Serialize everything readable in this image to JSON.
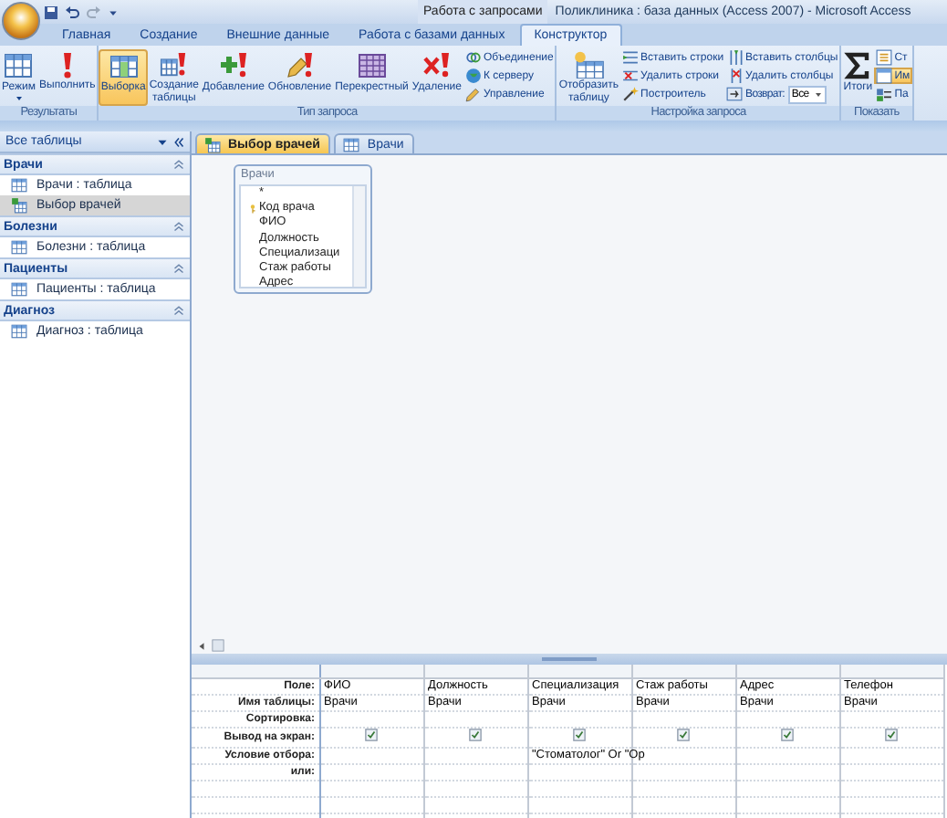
{
  "title_bar": {
    "context_label": "Работа с запросами",
    "title": "Поликлиника : база данных (Access 2007) - Microsoft Access"
  },
  "ribbon_tabs": [
    {
      "label": "Главная",
      "selected": false
    },
    {
      "label": "Создание",
      "selected": false
    },
    {
      "label": "Внешние данные",
      "selected": false
    },
    {
      "label": "Работа с базами данных",
      "selected": false
    },
    {
      "label": "Конструктор",
      "selected": true
    }
  ],
  "ribbon_groups": [
    {
      "label": "Результаты",
      "items": [
        {
          "kind": "large",
          "label": "Режим",
          "has_menu": true
        },
        {
          "kind": "large",
          "label": "Выполнить"
        }
      ]
    },
    {
      "label": "Тип запроса",
      "items": [
        {
          "kind": "large",
          "label": "Выборка",
          "selected": true
        },
        {
          "kind": "large",
          "label": "Создание таблицы",
          "selected": false
        },
        {
          "kind": "large",
          "label": "Добавление",
          "selected": false
        },
        {
          "kind": "large",
          "label": "Обновление",
          "selected": false
        },
        {
          "kind": "large",
          "label": "Перекрестный",
          "selected": false
        },
        {
          "kind": "large",
          "label": "Удаление",
          "selected": false
        },
        {
          "kind": "small",
          "label": "Объединение",
          "selected": false
        },
        {
          "kind": "small",
          "label": "К серверу",
          "selected": false
        },
        {
          "kind": "small",
          "label": "Управление",
          "selected": false
        }
      ]
    },
    {
      "label": "Настройка запроса",
      "items": [
        {
          "kind": "large",
          "label": "Отобразить таблицу"
        },
        {
          "kind": "small",
          "label": "Вставить строки"
        },
        {
          "kind": "small",
          "label": "Удалить строки"
        },
        {
          "kind": "small",
          "label": "Построитель"
        },
        {
          "kind": "small",
          "label": "Вставить столбцы"
        },
        {
          "kind": "small",
          "label": "Удалить столбцы"
        },
        {
          "kind": "combo",
          "label": "Возврат:",
          "value": "Все"
        }
      ]
    },
    {
      "label": "Показать",
      "items": [
        {
          "kind": "large",
          "label": "Итоги",
          "selected": false
        },
        {
          "kind": "small",
          "label": "Ст",
          "selected": false
        },
        {
          "kind": "small",
          "label": "Им",
          "selected": true
        },
        {
          "kind": "small",
          "label": "Па",
          "selected": false
        }
      ]
    }
  ],
  "navigation_pane": {
    "title": "Все таблицы",
    "groups": [
      {
        "label": "Врачи",
        "items": [
          {
            "kind": "table",
            "label": "Врачи : таблица",
            "selected": false
          },
          {
            "kind": "query",
            "label": "Выбор врачей",
            "selected": true
          }
        ]
      },
      {
        "label": "Болезни",
        "items": [
          {
            "kind": "table",
            "label": "Болезни : таблица",
            "selected": false
          }
        ]
      },
      {
        "label": "Пациенты",
        "items": [
          {
            "kind": "table",
            "label": "Пациенты : таблица",
            "selected": false
          }
        ]
      },
      {
        "label": "Диагноз",
        "items": [
          {
            "kind": "table",
            "label": "Диагноз : таблица",
            "selected": false
          }
        ]
      }
    ]
  },
  "document_tabs": [
    {
      "kind": "query",
      "label": "Выбор врачей",
      "selected": true
    },
    {
      "kind": "table",
      "label": "Врачи",
      "selected": false
    }
  ],
  "field_list": {
    "title": "Врачи",
    "fields": [
      {
        "label": "*",
        "key": false
      },
      {
        "label": "Код врача",
        "key": true
      },
      {
        "label": "ФИО",
        "key": false
      },
      {
        "label": "Должность",
        "key": false
      },
      {
        "label": "Специализаци",
        "key": false
      },
      {
        "label": "Стаж работы",
        "key": false
      },
      {
        "label": "Адрес",
        "key": false
      }
    ]
  },
  "design_grid": {
    "row_labels": [
      "Поле:",
      "Имя таблицы:",
      "Сортировка:",
      "Вывод на экран:",
      "Условие отбора:",
      "или:"
    ],
    "columns": [
      {
        "field": "ФИО",
        "table": "Врачи",
        "show": true
      },
      {
        "field": "Должность",
        "table": "Врачи",
        "show": true
      },
      {
        "field": "Специализация",
        "table": "Врачи",
        "show": true,
        "criteria": "\"Стоматолог\" Or \"Ор"
      },
      {
        "field": "Стаж работы",
        "table": "Врачи",
        "show": true
      },
      {
        "field": "Адрес",
        "table": "Врачи",
        "show": true
      },
      {
        "field": "Телефон",
        "table": "Врачи",
        "show": true
      }
    ]
  }
}
